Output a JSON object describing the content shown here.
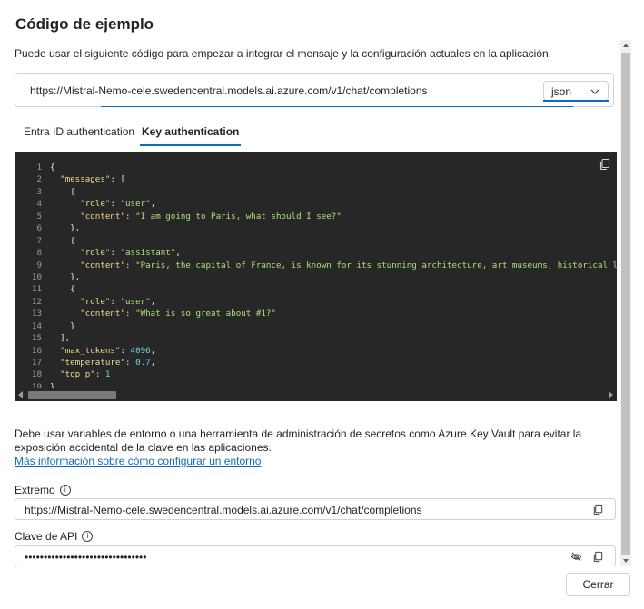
{
  "dialog": {
    "title": "Código de ejemplo",
    "description": "Puede usar el siguiente código para empezar a integrar el mensaje y la configuración actuales en la aplicación.",
    "close_label": "Cerrar"
  },
  "endpoint_bar": {
    "url": "https://Mistral-Nemo-cele.swedencentral.models.ai.azure.com/v1/chat/completions",
    "format_selected": "json"
  },
  "tabs": [
    {
      "label": "Entra ID authentication",
      "selected": false
    },
    {
      "label": "Key authentication",
      "selected": true
    }
  ],
  "code": {
    "language": "json",
    "lines": [
      "{",
      "  \"messages\": [",
      "    {",
      "      \"role\": \"user\",",
      "      \"content\": \"I am going to Paris, what should I see?\"",
      "    },",
      "    {",
      "      \"role\": \"assistant\",",
      "      \"content\": \"Paris, the capital of France, is known for its stunning architecture, art museums, historical landmarks, and",
      "    },",
      "    {",
      "      \"role\": \"user\",",
      "      \"content\": \"What is so great about #1?\"",
      "    }",
      "  ],",
      "  \"max_tokens\": 4096,",
      "  \"temperature\": 0.7,",
      "  \"top_p\": 1",
      "}"
    ]
  },
  "warning_text": "Debe usar variables de entorno o una herramienta de administración de secretos como Azure Key Vault para evitar la exposición accidental de la clave en las aplicaciones.",
  "more_info_link": "Más información sobre cómo configurar un entorno",
  "fields": {
    "endpoint": {
      "label": "Extremo",
      "value": "https://Mistral-Nemo-cele.swedencentral.models.ai.azure.com/v1/chat/completions"
    },
    "api_key": {
      "label": "Clave de API",
      "value": "••••••••••••••••••••••••••••••••"
    }
  },
  "icons": {
    "copy": "copy-icon",
    "hide": "eye-off-icon",
    "info": "info-icon",
    "chevron": "chevron-down-icon"
  },
  "colors": {
    "accent": "#0f6cbd",
    "code_bg": "#272727",
    "code_key": "#f0d98c",
    "code_string": "#ace07a",
    "code_number": "#68d6ef"
  }
}
